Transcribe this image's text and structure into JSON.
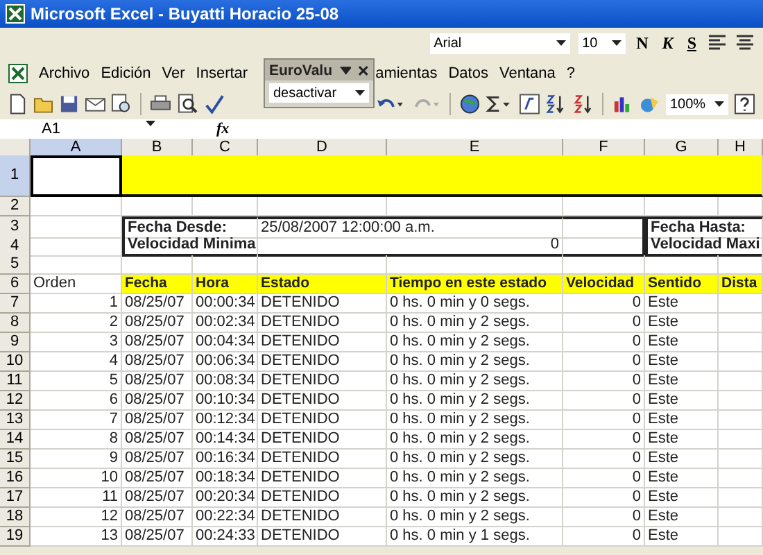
{
  "window": {
    "title": "Microsoft Excel - Buyatti Horacio 25-08"
  },
  "formatting_toolbar": {
    "font": "Arial",
    "size": "10",
    "buttons": [
      "N",
      "K",
      "S"
    ]
  },
  "menu": [
    "Archivo",
    "Edición",
    "Ver",
    "Insertar",
    "amientas",
    "Datos",
    "Ventana",
    "?"
  ],
  "floating_toolbar": {
    "title": "EuroValu",
    "dropdown": "desactivar"
  },
  "standard_toolbar": {
    "zoom": "100%"
  },
  "formula_bar": {
    "name_box": "A1",
    "fx": "fx"
  },
  "columns": [
    {
      "label": "A",
      "selected": true
    },
    {
      "label": "B",
      "selected": false
    },
    {
      "label": "C",
      "selected": false
    },
    {
      "label": "D",
      "selected": false
    },
    {
      "label": "E",
      "selected": false
    },
    {
      "label": "F",
      "selected": false
    },
    {
      "label": "G",
      "selected": false
    },
    {
      "label": "H",
      "selected": false
    }
  ],
  "row_headers": [
    {
      "label": "1",
      "selected": true
    },
    {
      "label": "2",
      "selected": false
    },
    {
      "label": "3",
      "selected": false
    },
    {
      "label": "4",
      "selected": false
    },
    {
      "label": "5",
      "selected": false
    },
    {
      "label": "6",
      "selected": false
    },
    {
      "label": "7",
      "selected": false
    },
    {
      "label": "8",
      "selected": false
    },
    {
      "label": "9",
      "selected": false
    },
    {
      "label": "10",
      "selected": false
    },
    {
      "label": "11",
      "selected": false
    },
    {
      "label": "12",
      "selected": false
    },
    {
      "label": "13",
      "selected": false
    },
    {
      "label": "14",
      "selected": false
    },
    {
      "label": "15",
      "selected": false
    },
    {
      "label": "16",
      "selected": false
    },
    {
      "label": "17",
      "selected": false
    },
    {
      "label": "18",
      "selected": false
    },
    {
      "label": "19",
      "selected": false
    }
  ],
  "filter": {
    "fecha_desde_label": "Fecha Desde:",
    "fecha_desde": "25/08/2007 12:00:00 a.m.",
    "fecha_hasta_label": "Fecha Hasta:",
    "velocidad_minima_label": "Velocidad Minima",
    "velocidad_minima": "0",
    "velocidad_maxima_label": "Velocidad Maxi"
  },
  "table": {
    "columns": [
      "Orden",
      "Fecha",
      "Hora",
      "Estado",
      "Tiempo en este estado",
      "Velocidad",
      "Sentido",
      "Dista"
    ],
    "rows": [
      [
        "1",
        "08/25/07",
        "00:00:34",
        "DETENIDO",
        "0 hs. 0 min y 0 segs.",
        "0",
        "Este"
      ],
      [
        "2",
        "08/25/07",
        "00:02:34",
        "DETENIDO",
        "0 hs. 0 min y 2 segs.",
        "0",
        "Este"
      ],
      [
        "3",
        "08/25/07",
        "00:04:34",
        "DETENIDO",
        "0 hs. 0 min y 2 segs.",
        "0",
        "Este"
      ],
      [
        "4",
        "08/25/07",
        "00:06:34",
        "DETENIDO",
        "0 hs. 0 min y 2 segs.",
        "0",
        "Este"
      ],
      [
        "5",
        "08/25/07",
        "00:08:34",
        "DETENIDO",
        "0 hs. 0 min y 2 segs.",
        "0",
        "Este"
      ],
      [
        "6",
        "08/25/07",
        "00:10:34",
        "DETENIDO",
        "0 hs. 0 min y 2 segs.",
        "0",
        "Este"
      ],
      [
        "7",
        "08/25/07",
        "00:12:34",
        "DETENIDO",
        "0 hs. 0 min y 2 segs.",
        "0",
        "Este"
      ],
      [
        "8",
        "08/25/07",
        "00:14:34",
        "DETENIDO",
        "0 hs. 0 min y 2 segs.",
        "0",
        "Este"
      ],
      [
        "9",
        "08/25/07",
        "00:16:34",
        "DETENIDO",
        "0 hs. 0 min y 2 segs.",
        "0",
        "Este"
      ],
      [
        "10",
        "08/25/07",
        "00:18:34",
        "DETENIDO",
        "0 hs. 0 min y 2 segs.",
        "0",
        "Este"
      ],
      [
        "11",
        "08/25/07",
        "00:20:34",
        "DETENIDO",
        "0 hs. 0 min y 2 segs.",
        "0",
        "Este"
      ],
      [
        "12",
        "08/25/07",
        "00:22:34",
        "DETENIDO",
        "0 hs. 0 min y 2 segs.",
        "0",
        "Este"
      ],
      [
        "13",
        "08/25/07",
        "00:24:33",
        "DETENIDO",
        "0 hs. 0 min y 1 segs.",
        "0",
        "Este"
      ]
    ]
  }
}
